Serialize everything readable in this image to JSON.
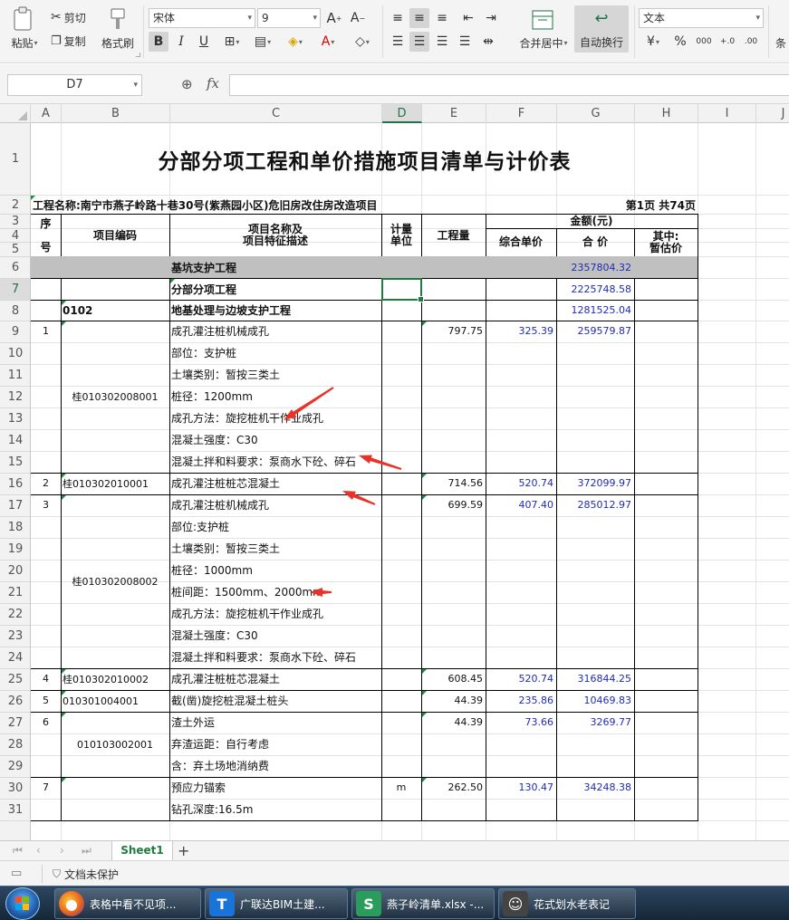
{
  "ribbon": {
    "paste": "粘贴",
    "cut": "剪切",
    "copy": "复制",
    "format_painter": "格式刷",
    "font_name": "宋体",
    "font_size": "9",
    "merge_center": "合并居中",
    "auto_wrap": "自动换行",
    "number_format": "文本",
    "cond_partial": "条"
  },
  "formula_bar": {
    "name_box": "D7",
    "fx": "fx",
    "formula": ""
  },
  "columns": [
    "A",
    "B",
    "C",
    "D",
    "E",
    "F",
    "G",
    "H",
    "I",
    "J"
  ],
  "rows": [
    "1",
    "2",
    "3",
    "4",
    "5",
    "6",
    "7",
    "8",
    "9",
    "10",
    "11",
    "12",
    "13",
    "14",
    "15",
    "16",
    "17",
    "18",
    "19",
    "20",
    "21",
    "22",
    "23",
    "24",
    "25",
    "26",
    "27",
    "28",
    "29",
    "30",
    "31"
  ],
  "sheet": {
    "title": "分部分项工程和单价措施项目清单与计价表",
    "project": "工程名称:南宁市燕子岭路十巷30号(紫燕园小区)危旧房改住房改造项目",
    "page": "第1页  共74页",
    "headers": {
      "seq": "序\n\n号",
      "code": "项目编码",
      "name": "项目名称及\n项目特征描述",
      "unit": "计量\n单位",
      "qty": "工程量",
      "amount": "金额(元)",
      "unit_price": "综合单价",
      "total": "合  价",
      "estimate": "其中:\n暂估价"
    },
    "sections": {
      "r6_name": "基坑支护工程",
      "r6_total": "2357804.32",
      "r7_name": "分部分项工程",
      "r7_total": "2225748.58",
      "r8_code": "0102",
      "r8_name": "地基处理与边坡支护工程",
      "r8_total": "1281525.04"
    },
    "items": [
      {
        "seq": "1",
        "code": "桂010302008001",
        "qty": "797.75",
        "price": "325.39",
        "total": "259579.87",
        "unit": "",
        "lines": [
          "成孔灌注桩机械成孔",
          "部位：支护桩",
          "土壤类别：暂按三类土",
          "桩径：1200mm",
          "成孔方法：旋挖桩机干作业成孔",
          "混凝土强度：C30",
          "混凝土拌和料要求：泵商水下砼、碎石"
        ]
      },
      {
        "seq": "2",
        "code": "桂010302010001",
        "qty": "714.56",
        "price": "520.74",
        "total": "372099.97",
        "unit": "",
        "lines": [
          "成孔灌注桩桩芯混凝土"
        ]
      },
      {
        "seq": "3",
        "code": "桂010302008002",
        "qty": "699.59",
        "price": "407.40",
        "total": "285012.97",
        "unit": "",
        "lines": [
          "成孔灌注桩机械成孔",
          "部位:支护桩",
          "土壤类别：暂按三类土",
          "桩径：1000mm",
          "桩间距：1500mm、2000mm",
          "成孔方法：旋挖桩机干作业成孔",
          "混凝土强度：C30",
          "混凝土拌和料要求：泵商水下砼、碎石"
        ]
      },
      {
        "seq": "4",
        "code": "桂010302010002",
        "qty": "608.45",
        "price": "520.74",
        "total": "316844.25",
        "unit": "",
        "lines": [
          "成孔灌注桩桩芯混凝土"
        ]
      },
      {
        "seq": "5",
        "code": "010301004001",
        "qty": "44.39",
        "price": "235.86",
        "total": "10469.83",
        "unit": "",
        "lines": [
          "截(凿)旋挖桩混凝土桩头"
        ]
      },
      {
        "seq": "6",
        "code": "010103002001",
        "qty": "44.39",
        "price": "73.66",
        "total": "3269.77",
        "unit": "",
        "lines": [
          "渣土外运",
          "弃渣运距：自行考虑",
          "含：弃土场地消纳费"
        ]
      },
      {
        "seq": "7",
        "code": "",
        "qty": "262.50",
        "price": "130.47",
        "total": "34248.38",
        "unit": "m",
        "lines": [
          "预应力锚索",
          "钻孔深度:16.5m"
        ]
      }
    ]
  },
  "tabs": {
    "active": "Sheet1"
  },
  "status": {
    "protect": "文档未保护"
  },
  "taskbar": {
    "items": [
      {
        "label": "表格中看不见项...",
        "icon": "firefox-icon",
        "color": "#e8641b"
      },
      {
        "label": "广联达BIM土建...",
        "icon": "glodon-icon",
        "color": "#1a73d9"
      },
      {
        "label": "燕子岭清单.xlsx -...",
        "icon": "wps-spreadsheet-icon",
        "color": "#2a9d5c"
      },
      {
        "label": "花式划水老表记",
        "icon": "avatar-icon",
        "color": "#444"
      }
    ]
  },
  "annotations": {
    "arrow_color": "#e8322a",
    "arrows": 5
  }
}
